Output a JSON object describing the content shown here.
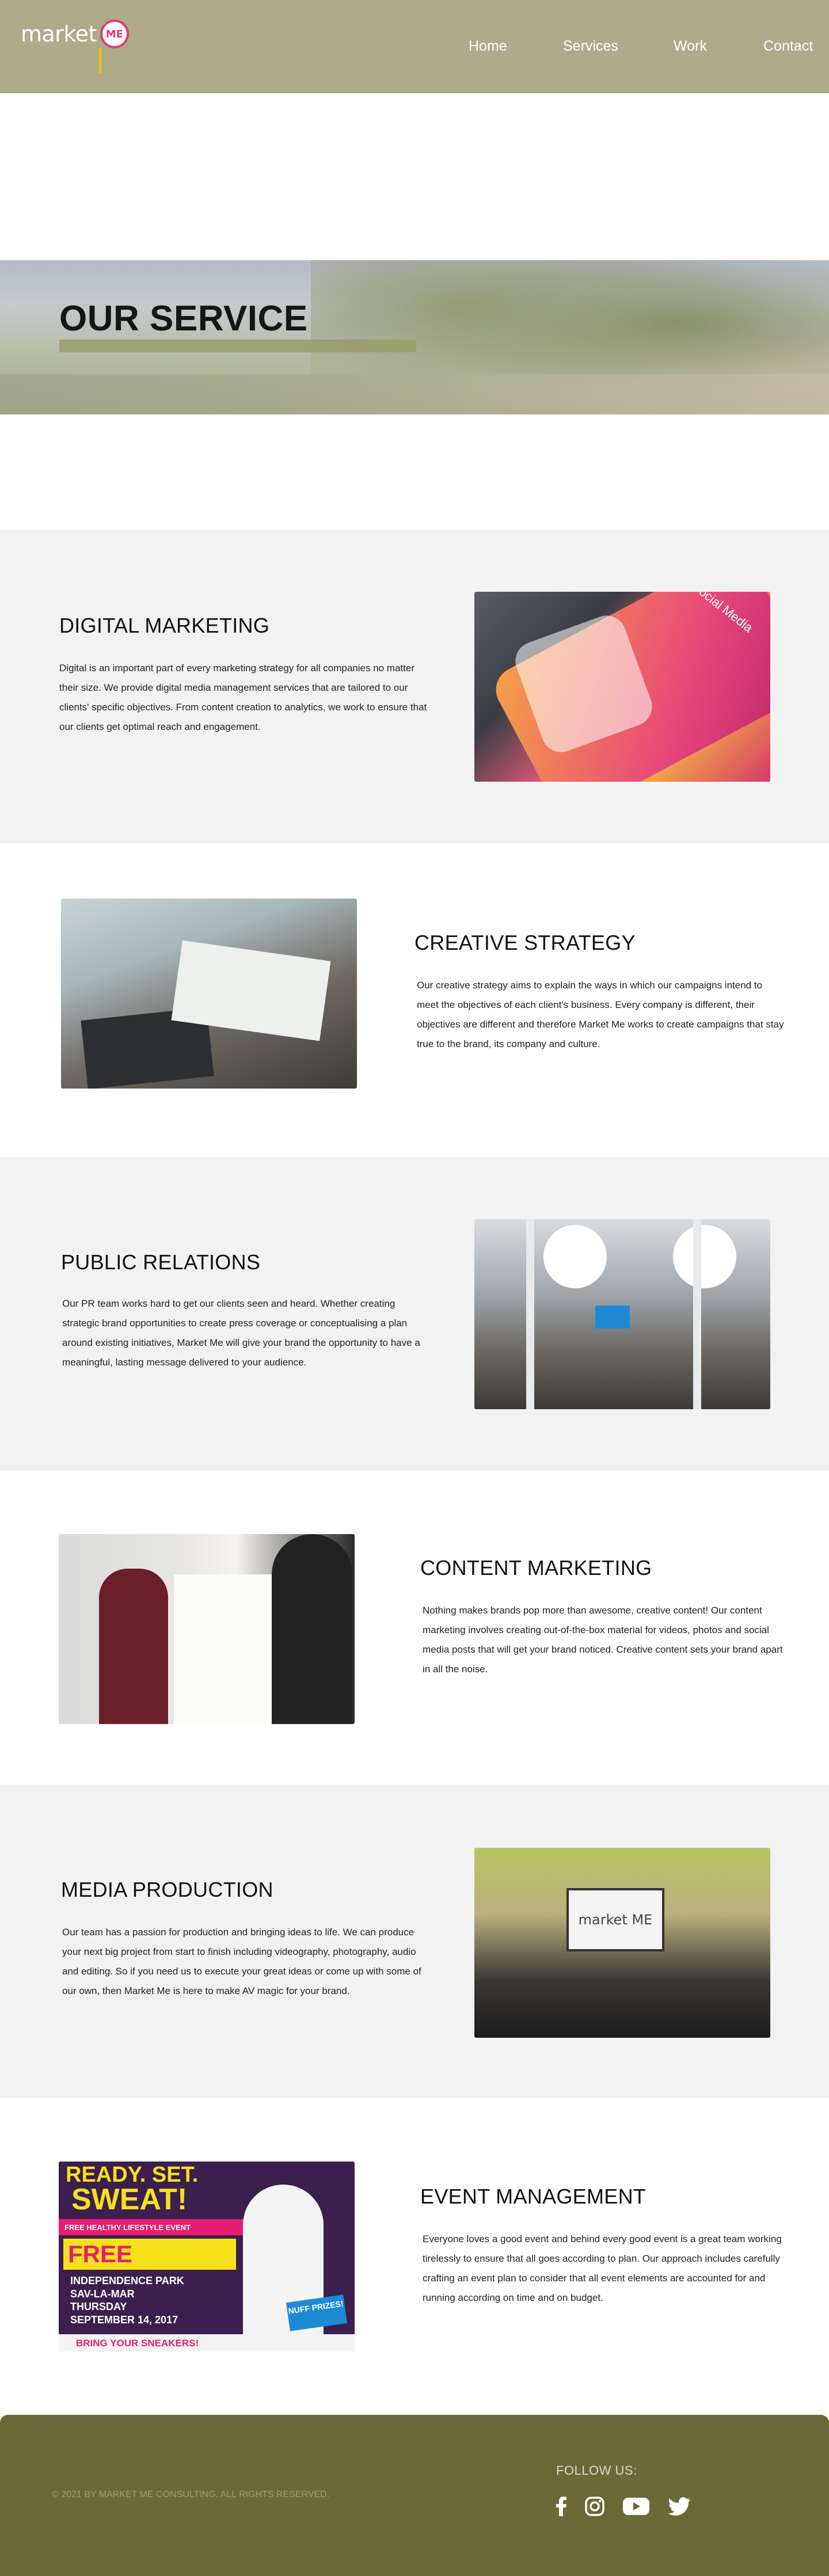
{
  "header": {
    "logo_text": "market",
    "logo_badge": "ME",
    "nav": [
      "Home",
      "Services",
      "Work",
      "Contact"
    ]
  },
  "banner": {
    "title": "OUR SERVICE"
  },
  "services": [
    {
      "title": "DIGITAL MARKETING",
      "body": "Digital is an important part of every marketing strategy for all companies no matter their size. We provide digital media management services that are tailored to our clients' specific objectives. From content creation to analytics, we work to ensure that our clients get optimal reach and engagement.",
      "image_label": "Social Media"
    },
    {
      "title": "CREATIVE STRATEGY",
      "body": "Our creative strategy aims to explain the ways in which our campaigns intend to meet the objectives of each client's business. Every company is different, their objectives are different and therefore Market Me works to create campaigns that stay true to the brand, its company and culture."
    },
    {
      "title": "PUBLIC RELATIONS",
      "body": "Our PR team works hard to get our clients seen and heard. Whether creating strategic brand opportunities to create press coverage or conceptualising a plan around existing initiatives, Market Me will give your brand the opportunity to have a meaningful, lasting message delivered to your audience."
    },
    {
      "title": "CONTENT MARKETING",
      "body": "Nothing makes brands pop more than awesome, creative content! Our content marketing involves creating out-of-the-box material for videos, photos and social media posts that will get your brand noticed. Creative content sets your  brand apart in all the noise."
    },
    {
      "title": "MEDIA PRODUCTION",
      "body": "Our team has a passion for production and bringing ideas to life. We can produce your next big project from start to finish including videography, photography, audio and editing. So if you need us to execute your great ideas or come up with some of our own, then Market Me is here to make AV magic for your brand.",
      "image_sign": "market ME"
    },
    {
      "title": "EVENT MANAGEMENT",
      "body": "Everyone loves a good event and behind every good event is a great team working tirelessly to ensure that all goes according to plan. Our approach includes carefully crafting an event plan to consider that all event elements are accounted for and running according on time and on budget.",
      "poster": {
        "headline": "READY. SET.",
        "headline2": "SWEAT!",
        "tagline": "FREE HEALTHY LIFESTYLE EVENT",
        "free": "FREE",
        "location": "INDEPENDENCE PARK",
        "city": "SAV-LA-MAR",
        "day": "THURSDAY",
        "date": "SEPTEMBER 14, 2017",
        "prize": "NUFF PRIZES!",
        "bottom": "BRING YOUR SNEAKERS!"
      }
    }
  ],
  "footer": {
    "copyright": "© 2021 BY MARKET ME CONSULTING. ALL RIGHTS RESERVED.",
    "follow_label": "FOLLOW US:",
    "social": [
      "facebook-icon",
      "instagram-icon",
      "youtube-icon",
      "twitter-icon"
    ]
  },
  "colors": {
    "header_bg": "#adab89",
    "footer_bg": "#6a6a38",
    "accent_pink": "#e63a78",
    "section_grey": "#f2f2f2"
  }
}
